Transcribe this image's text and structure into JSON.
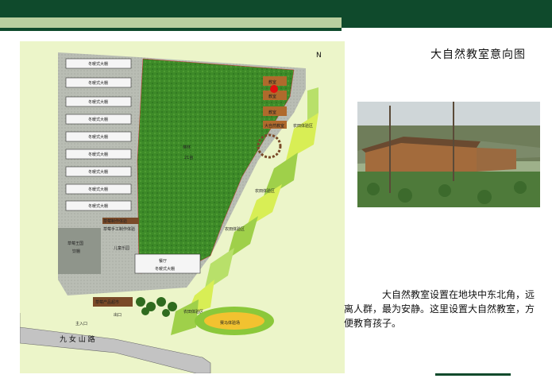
{
  "title": "大自然教室意向图",
  "description": "大自然教室设置在地块中东北角，远离人群，最为安静。这里设置大自然教室，方便教育孩子。",
  "map": {
    "greenhouses": [
      "冬暖式大棚",
      "冬暖式大棚",
      "冬暖式大棚",
      "冬暖式大棚",
      "冬暖式大棚",
      "冬暖式大棚",
      "冬暖式大棚",
      "冬暖式大棚",
      "冬暖式大棚"
    ],
    "field_label": "梯林",
    "field_sublabel": "21亩",
    "classroom_labels": [
      "教室",
      "教室",
      "教室",
      "大自然教室"
    ],
    "farm_zones": [
      "农田体验区",
      "农田体验区",
      "农田体验区",
      "农田体验区"
    ],
    "strawberry_area": [
      "草莓王国",
      "饮棚"
    ],
    "strawberry_items": [
      "草莓制作体验",
      "草莓手工制作体验"
    ],
    "kids_area": "儿童乐园",
    "restaurant": [
      "餐厅",
      "冬暖式大棚"
    ],
    "produce_shop": "草莓产品超市",
    "entrance": "主入口",
    "exit": "出口",
    "road": "九 女 山 路",
    "racing": "赛马体验场",
    "compass": "N"
  },
  "colors": {
    "header": "#0f4a2c",
    "header_light": "#b9cf9f",
    "field": "#3f8a2a"
  }
}
